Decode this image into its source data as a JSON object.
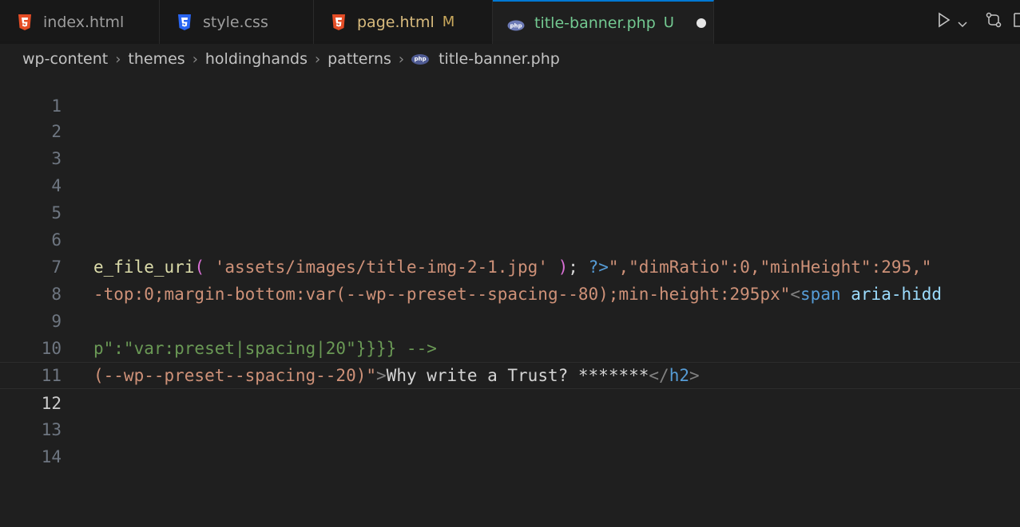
{
  "tabs": [
    {
      "label": "index.html",
      "icon": "html5-icon",
      "modifier": ""
    },
    {
      "label": "style.css",
      "icon": "css3-icon",
      "modifier": ""
    },
    {
      "label": "page.html",
      "icon": "html5-icon",
      "modifier": "M"
    },
    {
      "label": "title-banner.php",
      "icon": "php-icon",
      "modifier": "U",
      "unsaved": true
    }
  ],
  "breadcrumb": [
    "wp-content",
    "themes",
    "holdinghands",
    "patterns",
    "title-banner.php"
  ],
  "editor": {
    "line_numbers": [
      "1",
      "2",
      "3",
      "4",
      "5",
      "6",
      "7",
      "8",
      "9",
      "10",
      "11",
      "12",
      "13",
      "14"
    ],
    "current_line": "12",
    "line8": {
      "fn": "e_file_uri",
      "paren_open": "(",
      "str": " 'assets/images/title-img-2-1.jpg' ",
      "paren_close": ")",
      "semi": "; ",
      "php_close": "?>",
      "rest": "\",\"dimRatio\":0,\"minHeight\":295,\""
    },
    "line9": {
      "str": "-top:0;margin-bottom:var(--wp--preset--spacing--80);min-height:295px\"",
      "lt": "<",
      "tag": "span",
      "sp": " ",
      "attr": "aria-hidd"
    },
    "line11": {
      "text": "p\":\"var:preset|spacing|20\"}}}} -->"
    },
    "line12": {
      "str": "(--wp--preset--spacing--20)\"",
      "gt": ">",
      "text": "Why write a Trust? *******",
      "close_lt": "</",
      "close_tag": "h2",
      "close_gt": ">"
    }
  },
  "colors": {
    "background": "#1f1f1f",
    "tab_active_accent": "#0078d4",
    "untracked": "#73c991",
    "modified": "#d7ba7d"
  }
}
